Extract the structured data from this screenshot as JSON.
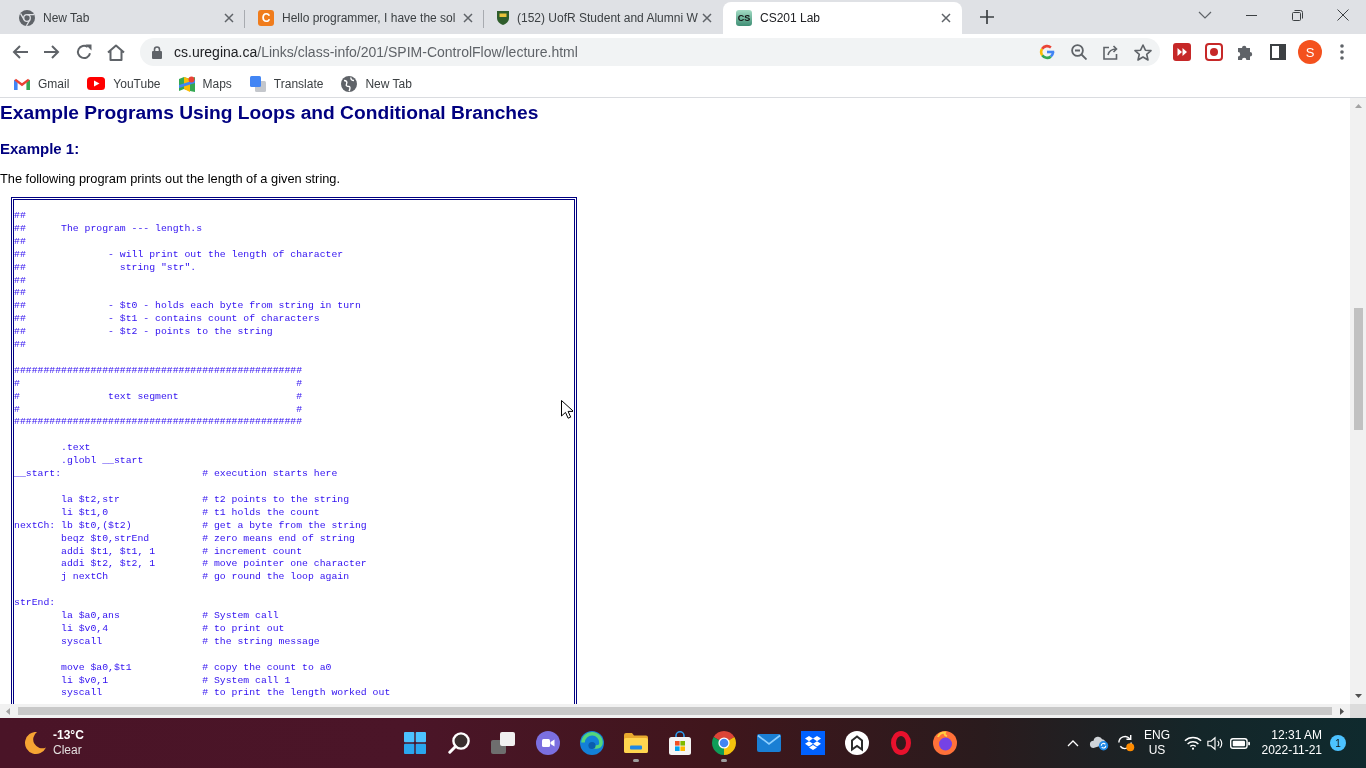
{
  "browser": {
    "tabs": [
      {
        "title": "New Tab",
        "selected": false
      },
      {
        "title": "Hello programmer, I have the sol",
        "selected": false,
        "favicon_letters": "C"
      },
      {
        "title": "(152) UofR Student and Alumni W",
        "selected": false
      },
      {
        "title": "CS201 Lab",
        "selected": true,
        "favicon_letters": "CS"
      }
    ],
    "address_bar": {
      "host": "cs.uregina.ca",
      "path": "/Links/class-info/201/SPIM-ControlFlow/lecture.html"
    },
    "profile": {
      "initial": "S"
    },
    "bookmarks": [
      "Gmail",
      "YouTube",
      "Maps",
      "Translate",
      "New Tab"
    ]
  },
  "page": {
    "heading": "Example Programs Using Loops and Conditional Branches",
    "subheading": "Example 1:",
    "intro": "The following program prints out the length of a given string.",
    "code_blocks": [
      "##\n##      The program --- length.s\n##\n##              - will print out the length of character\n##                string \"str\".\n##\n##\n##              - $t0 - holds each byte from string in turn\n##              - $t1 - contains count of characters\n##              - $t2 - points to the string\n##",
      "#################################################\n#                                               #\n#               text segment                    #\n#                                               #\n#################################################",
      "        .text\n        .globl __start\n__start:                        # execution starts here",
      "        la $t2,str              # t2 points to the string\n        li $t1,0                # t1 holds the count\nnextCh: lb $t0,($t2)            # get a byte from the string\n        beqz $t0,strEnd         # zero means end of string\n        addi $t1, $t1, 1        # increment count\n        addi $t2, $t2, 1        # move pointer one character\n        j nextCh                # go round the loop again",
      "strEnd:\n        la $a0,ans              # System call\n        li $v0,4                # to print out\n        syscall                 # the string message",
      "        move $a0,$t1            # copy the count to a0\n        li $v0,1                # System call 1\n        syscall                 # to print the length worked out"
    ]
  },
  "taskbar": {
    "weather": {
      "temperature": "-13°C",
      "condition": "Clear"
    },
    "apps": [
      {
        "running": false
      },
      {
        "running": false
      },
      {
        "running": false
      },
      {
        "running": false
      },
      {
        "running": false
      },
      {
        "running": true
      },
      {
        "running": false
      },
      {
        "running": true
      },
      {
        "running": false
      },
      {
        "running": false
      },
      {
        "running": false
      },
      {
        "running": false
      },
      {
        "running": false
      }
    ],
    "language": {
      "code": "ENG",
      "region": "US"
    },
    "clock": {
      "time": "12:31 AM",
      "date": "2022-11-21"
    },
    "notification_count": "1"
  }
}
